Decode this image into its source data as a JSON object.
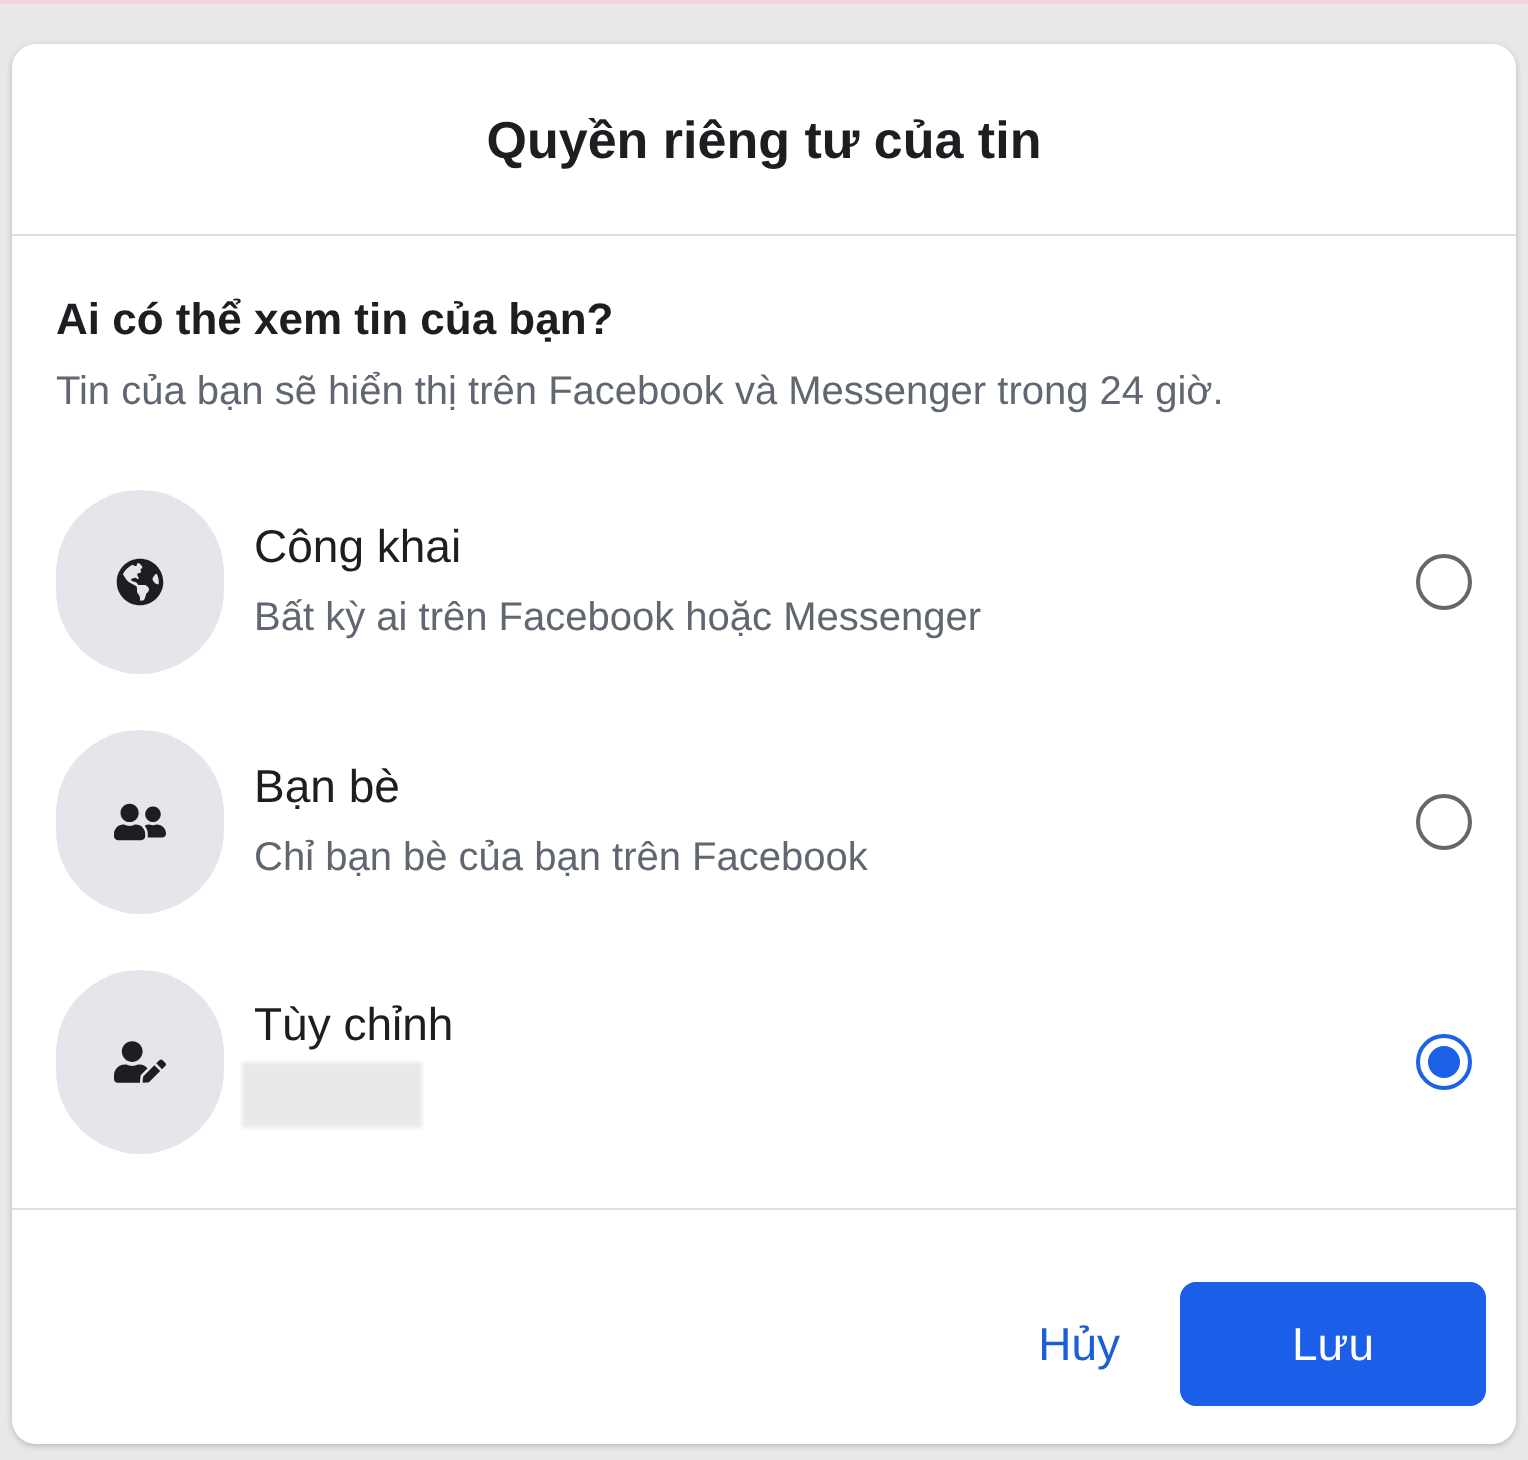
{
  "dialog": {
    "title": "Quyền riêng tư của tin"
  },
  "question": {
    "title": "Ai có thể xem tin của bạn?",
    "description": "Tin của bạn sẽ hiển thị trên Facebook và Messenger trong 24 giờ."
  },
  "options": [
    {
      "kind": "public",
      "title": "Công khai",
      "description": "Bất kỳ ai trên Facebook hoặc Messenger",
      "selected": false
    },
    {
      "kind": "friends",
      "title": "Bạn bè",
      "description": "Chỉ bạn bè của bạn trên Facebook",
      "selected": false
    },
    {
      "kind": "custom",
      "title": "Tùy chỉnh",
      "description_hidden": true,
      "selected": true
    }
  ],
  "buttons": [
    {
      "kind": "text",
      "label": "Hủy"
    },
    {
      "kind": "primary",
      "label": "Lưu"
    }
  ]
}
